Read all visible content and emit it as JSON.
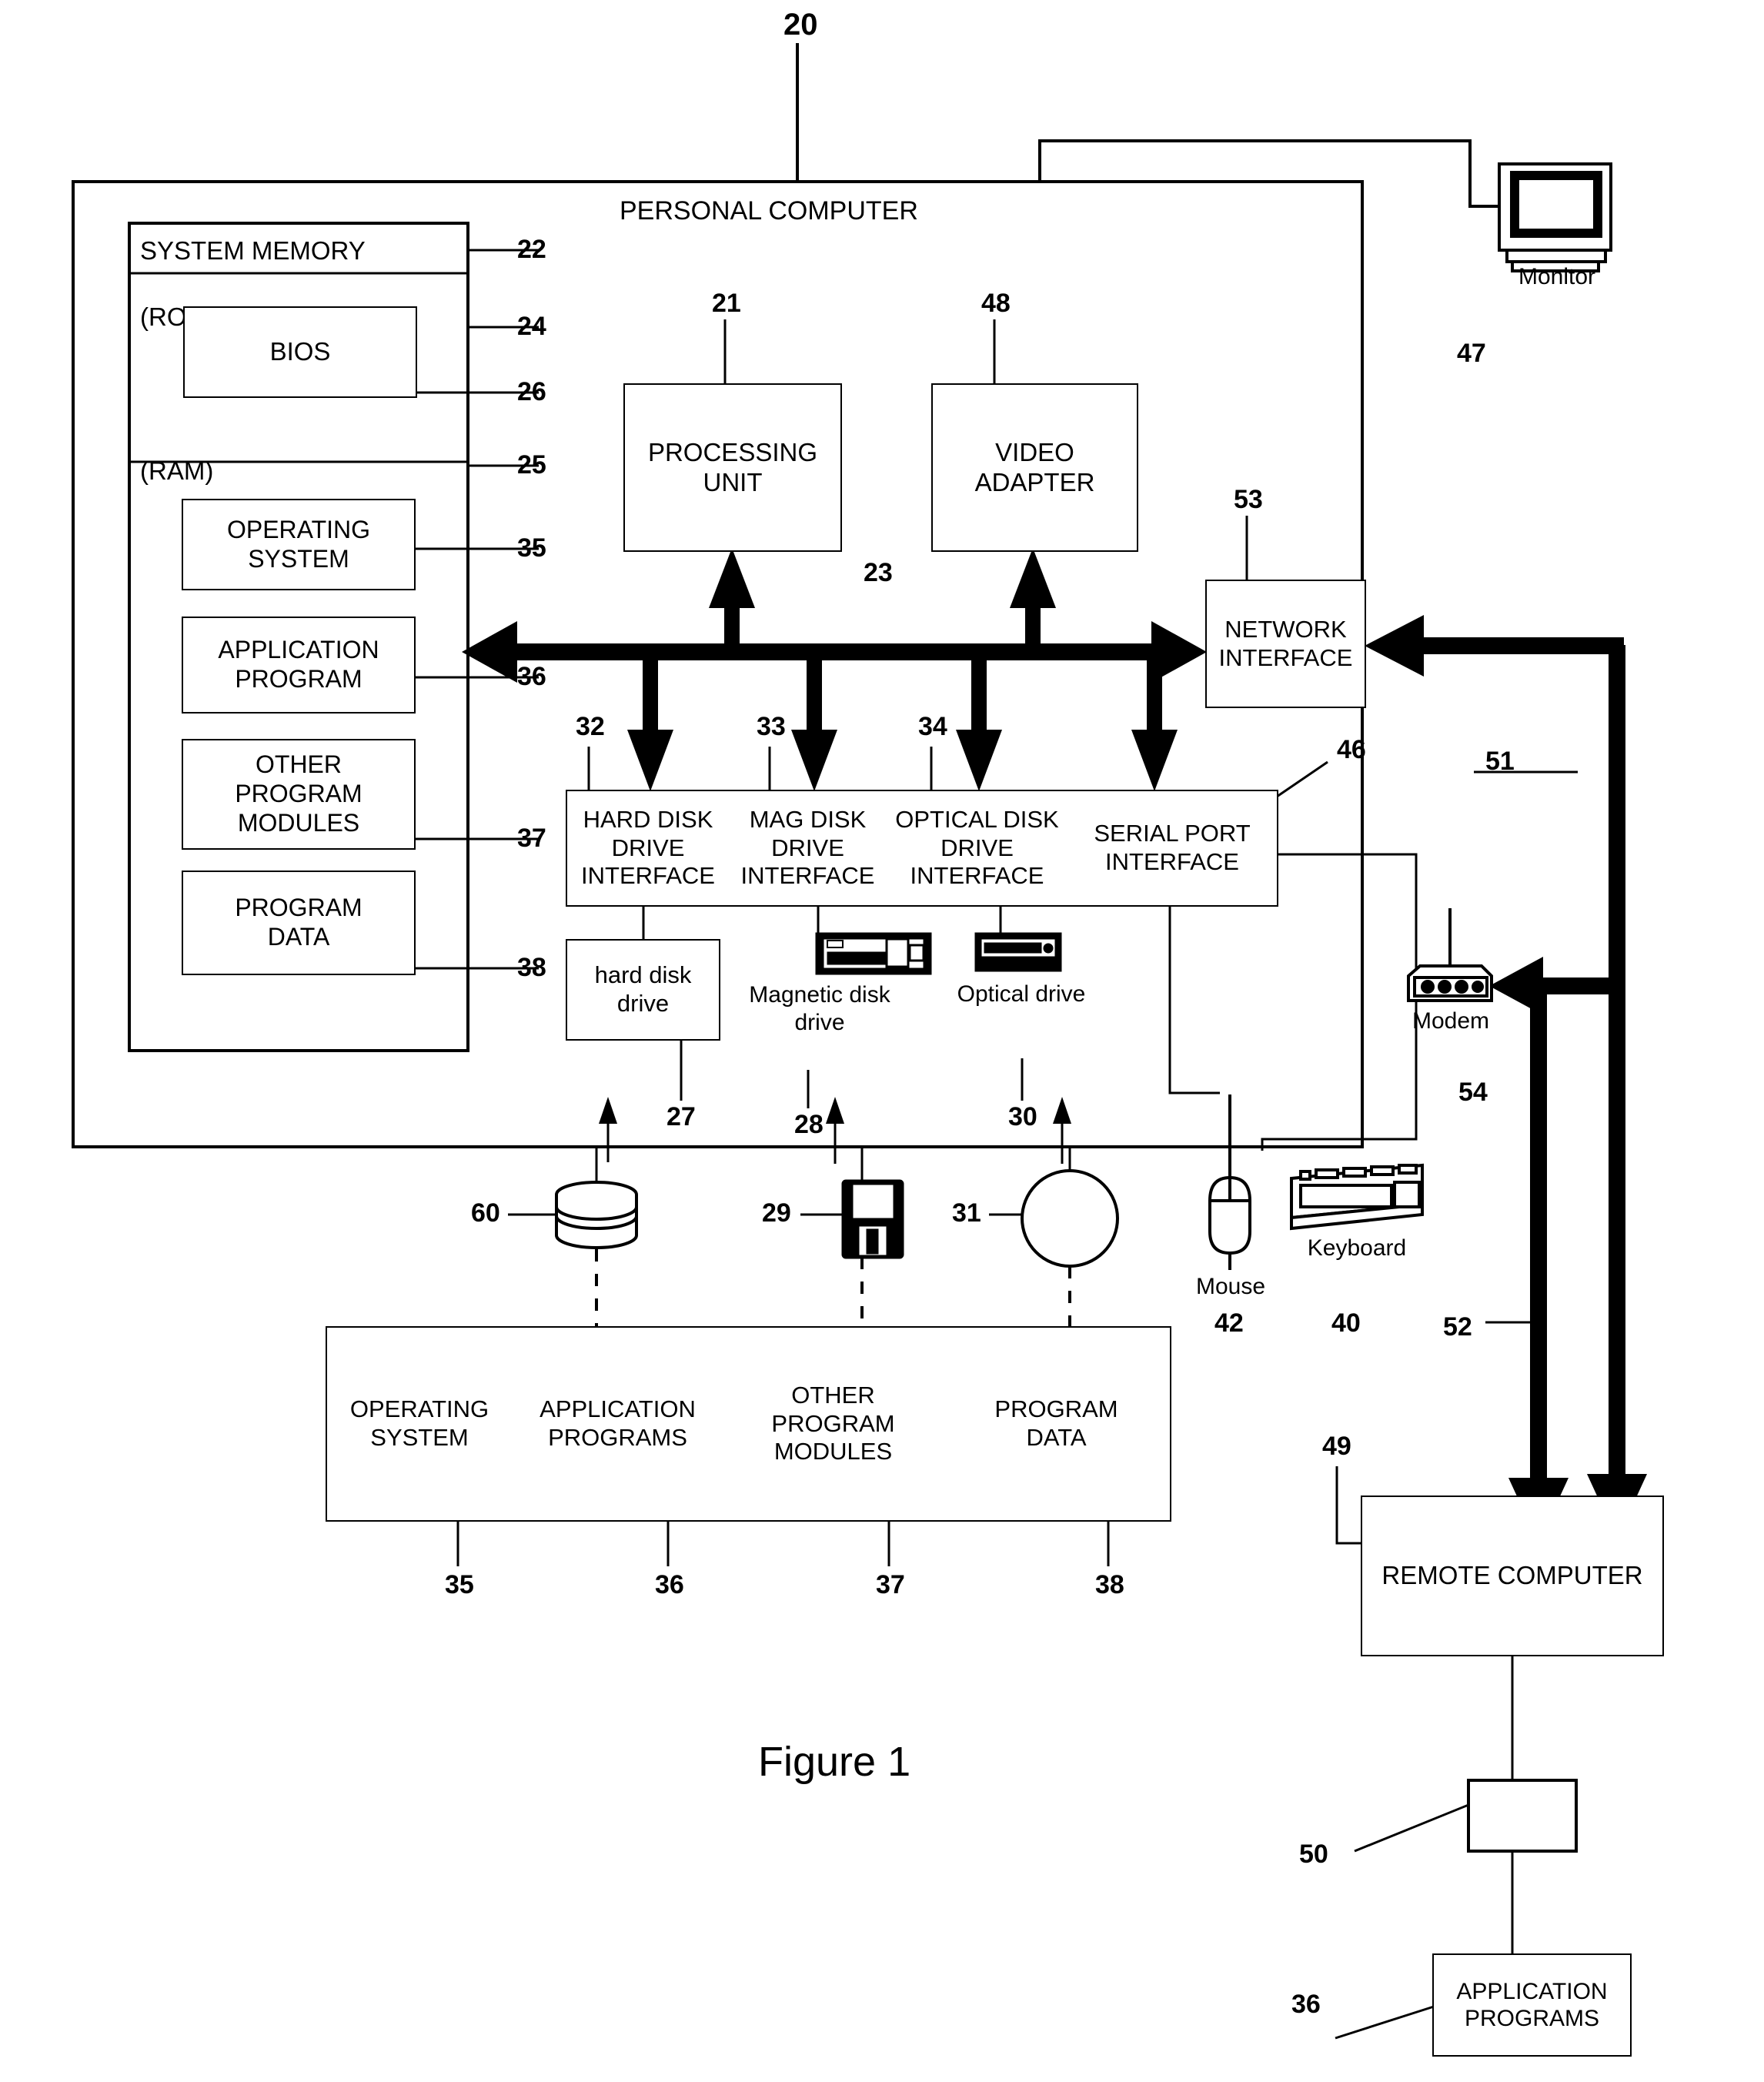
{
  "figure": {
    "caption": "Figure 1",
    "top_ref": "20",
    "title": "PERSONAL COMPUTER"
  },
  "system_memory": {
    "header": "SYSTEM MEMORY",
    "header_ref": "22",
    "rom_label": "(ROM)",
    "rom_ref": "24",
    "bios_label": "BIOS",
    "bios_ref": "26",
    "ram_label": "(RAM)",
    "ram_ref": "25",
    "blocks": [
      {
        "label": "OPERATING\nSYSTEM",
        "line1": "OPERATING",
        "line2": "SYSTEM",
        "ref": "35"
      },
      {
        "label": "APPLICATION\nPROGRAM",
        "line1": "APPLICATION",
        "line2": "PROGRAM",
        "ref": "36"
      },
      {
        "label": "OTHER\nPROGRAM\nMODULES",
        "line1": "OTHER",
        "line2": "PROGRAM",
        "line3": "MODULES",
        "ref": "37"
      },
      {
        "label": "PROGRAM\nDATA",
        "line1": "PROGRAM",
        "line2": "DATA",
        "ref": "38"
      }
    ]
  },
  "core": {
    "processing_unit": {
      "line1": "PROCESSING",
      "line2": "UNIT",
      "ref": "21"
    },
    "video_adapter": {
      "line1": "VIDEO",
      "line2": "ADAPTER",
      "ref": "48"
    },
    "bus_ref": "23",
    "network_interface": {
      "line1": "NETWORK",
      "line2": "INTERFACE",
      "ref": "53"
    }
  },
  "interfaces": [
    {
      "line1": "HARD DISK",
      "line2": "DRIVE",
      "line3": "INTERFACE",
      "ref": "32"
    },
    {
      "line1": "MAG DISK",
      "line2": "DRIVE",
      "line3": "INTERFACE",
      "ref": "33"
    },
    {
      "line1": "OPTICAL DISK",
      "line2": "DRIVE",
      "line3": "INTERFACE",
      "ref": "34"
    },
    {
      "line1": "SERIAL PORT",
      "line2": "INTERFACE",
      "ref": "46"
    }
  ],
  "drives": {
    "hard_disk": {
      "line1": "hard disk",
      "line2": "drive",
      "ref": "27"
    },
    "magnetic_disk": {
      "line1": "Magnetic disk",
      "line2": "drive",
      "ref": "28"
    },
    "optical": {
      "line1": "Optical drive",
      "ref": "30"
    }
  },
  "media": {
    "hard_disk_platter_ref": "60",
    "floppy_ref": "29",
    "cd_ref": "31"
  },
  "peripherals": {
    "monitor": {
      "label": "Monitor",
      "ref": "47"
    },
    "mouse": {
      "label": "Mouse",
      "ref": "42"
    },
    "keyboard": {
      "label": "Keyboard",
      "ref": "40"
    },
    "modem": {
      "label": "Modem",
      "ref": "54"
    }
  },
  "storage_contents": [
    {
      "line1": "OPERATING",
      "line2": "SYSTEM",
      "ref": "35"
    },
    {
      "line1": "APPLICATION",
      "line2": "PROGRAMS",
      "ref": "36"
    },
    {
      "line1": "OTHER",
      "line2": "PROGRAM",
      "line3": "MODULES",
      "ref": "37"
    },
    {
      "line1": "PROGRAM",
      "line2": "DATA",
      "ref": "38"
    }
  ],
  "remote": {
    "computer_label": "REMOTE COMPUTER",
    "computer_ref": "49",
    "storage_ref": "50",
    "app_programs": {
      "line1": "APPLICATION",
      "line2": "PROGRAMS",
      "ref": "36"
    }
  },
  "network_links": {
    "lan_ref": "51",
    "wan_ref": "52"
  },
  "colors": {
    "ink": "#000000",
    "paper": "#ffffff"
  }
}
